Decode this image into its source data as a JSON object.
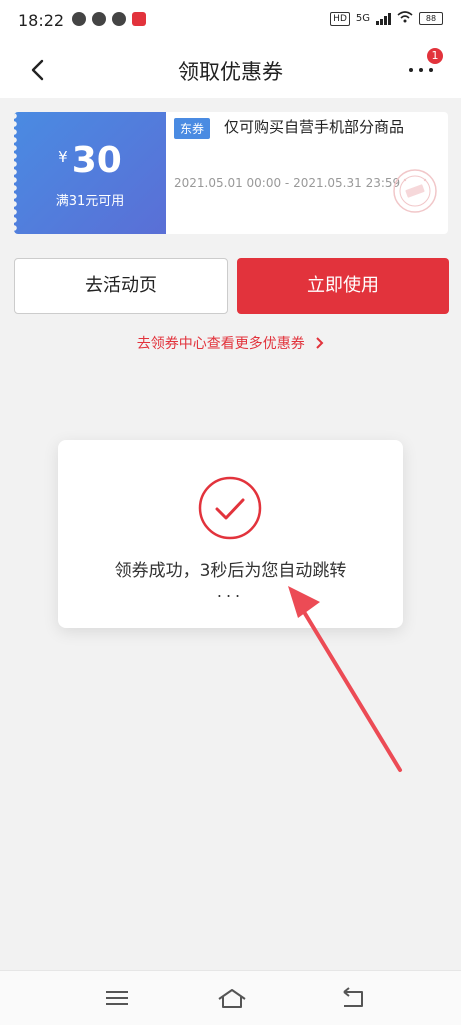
{
  "statusbar": {
    "time": "18:22",
    "network": "5G",
    "battery": "88"
  },
  "navbar": {
    "title": "领取优惠券",
    "badge_count": "1"
  },
  "coupon": {
    "currency": "¥",
    "amount": "30",
    "condition": "满31元可用",
    "tag": "东券",
    "description": "仅可购买自营手机部分商品",
    "validity": "2021.05.01 00:00 - 2021.05.31 23:59"
  },
  "buttons": {
    "activity": "去活动页",
    "use_now": "立即使用"
  },
  "center_link": {
    "label": "去领券中心查看更多优惠券",
    "chevron": "›"
  },
  "modal": {
    "message": "领券成功，3秒后为您自动跳转",
    "ellipsis": "..."
  },
  "colors": {
    "accent_red": "#e2333c",
    "coupon_blue": "#4a8be2"
  },
  "icons": [
    "back-icon",
    "more-icon",
    "success-check-icon",
    "menu-icon",
    "home-icon",
    "return-icon"
  ]
}
